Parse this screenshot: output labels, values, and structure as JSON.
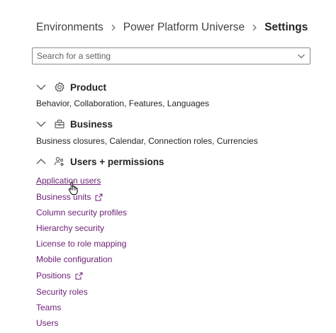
{
  "breadcrumb": {
    "items": [
      "Environments",
      "Power Platform Universe"
    ],
    "current": "Settings"
  },
  "search": {
    "placeholder": "Search for a setting",
    "value": ""
  },
  "sections": {
    "product": {
      "title": "Product",
      "description": "Behavior, Collaboration, Features, Languages",
      "expanded": false,
      "icon": "gear-icon"
    },
    "business": {
      "title": "Business",
      "description": "Business closures, Calendar, Connection roles, Currencies",
      "expanded": false,
      "icon": "briefcase-icon"
    },
    "users": {
      "title": "Users + permissions",
      "expanded": true,
      "icon": "people-settings-icon",
      "links": [
        "Application users",
        "Business units",
        "Column security profiles",
        "Hierarchy security",
        "License to role mapping",
        "Mobile configuration",
        "Positions",
        "Security roles",
        "Teams",
        "Users"
      ]
    }
  },
  "colors": {
    "link": "#6b1e74",
    "text": "#242424",
    "border": "#8a8a8a"
  }
}
